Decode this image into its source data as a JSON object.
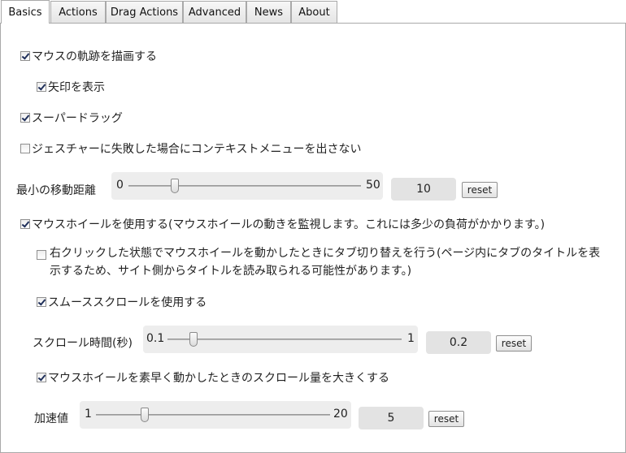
{
  "tabs": [
    {
      "label": "Basics",
      "active": true
    },
    {
      "label": "Actions"
    },
    {
      "label": "Drag Actions"
    },
    {
      "label": "Advanced"
    },
    {
      "label": "News"
    },
    {
      "label": "About"
    }
  ],
  "options": {
    "draw_trail": {
      "label": "マウスの軌跡を描画する",
      "checked": true
    },
    "show_arrow": {
      "label": "矢印を表示",
      "checked": true
    },
    "super_drag": {
      "label": "スーパードラッグ",
      "checked": true
    },
    "no_context_menu": {
      "label": "ジェスチャーに失敗した場合にコンテキストメニューを出さない",
      "checked": false
    },
    "use_wheel": {
      "label": "マウスホイールを使用する(マウスホイールの動きを監視します。これには多少の負荷がかかります。)",
      "checked": true
    },
    "tab_switch": {
      "label": "右クリックした状態でマウスホイールを動かしたときにタブ切り替えを行う(ページ内にタブのタイトルを表示するため、サイト側からタイトルを読み取られる可能性があります。)",
      "checked": false
    },
    "smooth_scroll": {
      "label": "スムーススクロールを使用する",
      "checked": true
    },
    "accelerate": {
      "label": "マウスホイールを素早く動かしたときのスクロール量を大きくする",
      "checked": true
    }
  },
  "sliders": {
    "min_distance": {
      "label": "最小の移動距離",
      "min": "0",
      "max": "50",
      "value": "10",
      "fraction": 0.2,
      "reset": "reset"
    },
    "scroll_time": {
      "label": "スクロール時間(秒)",
      "min": "0.1",
      "max": "1",
      "value": "0.2",
      "fraction": 0.111,
      "reset": "reset"
    },
    "acceleration": {
      "label": "加速値",
      "min": "1",
      "max": "20",
      "value": "5",
      "fraction": 0.21,
      "reset": "reset"
    }
  }
}
